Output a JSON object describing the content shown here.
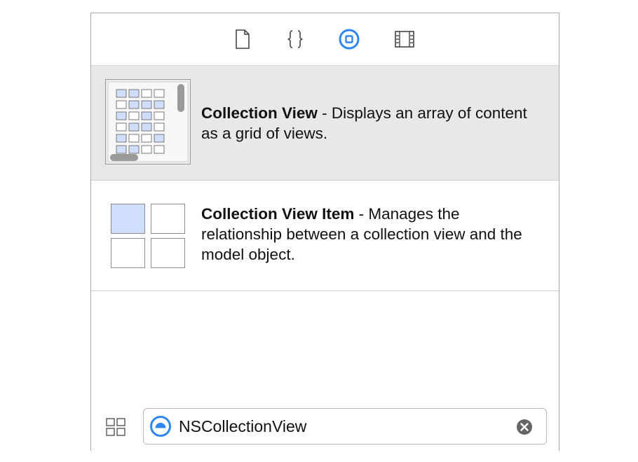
{
  "toolbar": {
    "tabs": [
      {
        "icon": "file-icon",
        "selected": false
      },
      {
        "icon": "braces-icon",
        "selected": false
      },
      {
        "icon": "object-library-icon",
        "selected": true
      },
      {
        "icon": "media-library-icon",
        "selected": false
      }
    ]
  },
  "library": {
    "items": [
      {
        "icon": "collection-view-icon",
        "title": "Collection View",
        "description": " - Displays an array of content as a grid of views.",
        "selected": true
      },
      {
        "icon": "collection-view-item-icon",
        "title": "Collection View Item",
        "description": " - Manages the relationship between a collection view and the model object.",
        "selected": false
      }
    ]
  },
  "search": {
    "value": "NSCollectionView",
    "scope_icon": "object-scope-icon",
    "clear_icon": "clear-icon",
    "filter_icon": "grid-view-icon"
  },
  "colors": {
    "accent": "#2f86f0",
    "selection_background": "#e8e8e8",
    "cell_fill": "#cfdffb"
  }
}
